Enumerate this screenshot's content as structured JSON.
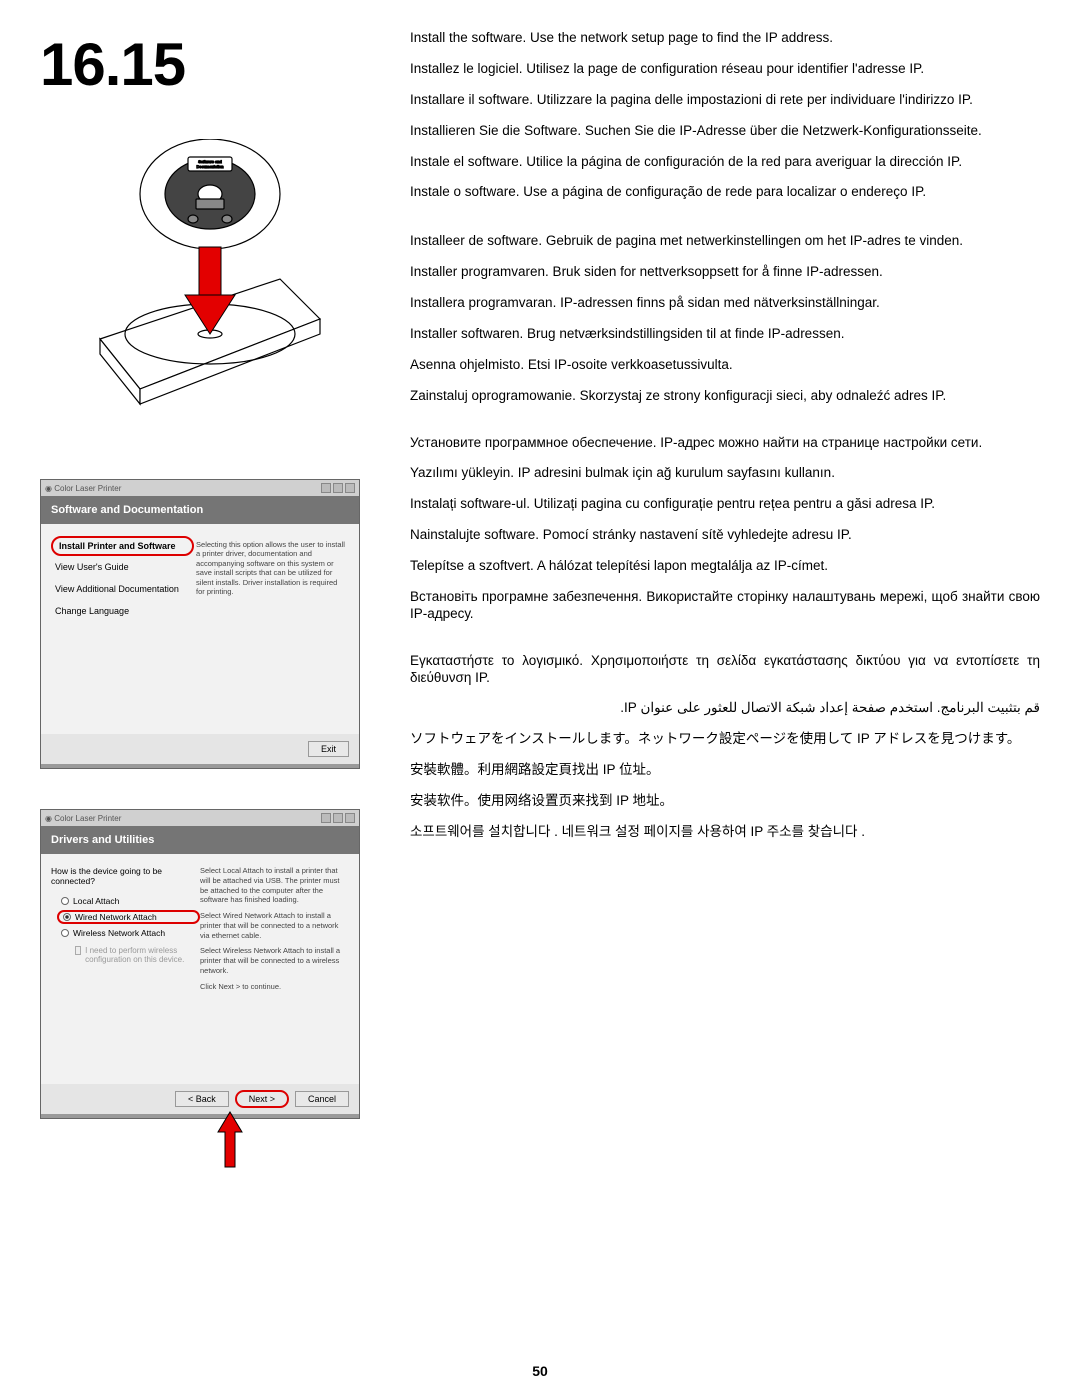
{
  "step_number": "16.15",
  "page_number": "50",
  "cd_label": "Software and Documentation",
  "installer1": {
    "window_title": "Color Laser Printer",
    "header": "Software and Documentation",
    "menu": {
      "install": "Install Printer and Software",
      "users_guide": "View User's Guide",
      "additional": "View Additional Documentation",
      "change_lang": "Change Language"
    },
    "desc": "Selecting this option allows the user to install a printer driver, documentation and accompanying software on this system or save install scripts that can be utilized for silent installs. Driver installation is required for printing.",
    "exit_btn": "Exit"
  },
  "installer2": {
    "window_title": "Color Laser Printer",
    "header": "Drivers and Utilities",
    "question": "How is the device going to be connected?",
    "opt_local": "Local Attach",
    "opt_wired": "Wired Network Attach",
    "opt_wireless": "Wireless Network Attach",
    "chk_text": "I need to perform wireless configuration on this device.",
    "desc_local": "Select Local Attach to install a printer that will be attached via USB. The printer must be attached to the computer after the software has finished loading.",
    "desc_wired": "Select Wired Network Attach to install a printer that will be connected to a network via ethernet cable.",
    "desc_wireless": "Select Wireless Network Attach to install a printer that will be connected to a wireless network.",
    "desc_next": "Click Next > to continue.",
    "back_btn": "< Back",
    "next_btn": "Next >",
    "cancel_btn": "Cancel"
  },
  "instructions": {
    "en": "Install the software. Use the network setup page to find the IP address.",
    "fr": "Installez le logiciel. Utilisez la page de configuration réseau pour identifier l'adresse IP.",
    "it": "Installare il software. Utilizzare la pagina delle impostazioni di rete per individuare l'indirizzo IP.",
    "de": "Installieren Sie die Software. Suchen Sie die IP-Adresse über die Netzwerk-Konfigurationsseite.",
    "es": "Instale el software. Utilice la página de configuración de la red para averiguar la dirección IP.",
    "pt": "Instale o software. Use a página de configuração de rede para localizar o endereço IP.",
    "nl": "Installeer de software. Gebruik de pagina met netwerkinstellingen om het IP-adres te vinden.",
    "no": "Installer programvaren. Bruk siden for nettverksoppsett for å finne IP-adressen.",
    "sv": "Installera programvaran. IP-adressen finns på sidan med nätverksinställningar.",
    "da": "Installer softwaren. Brug netværksindstillingsiden til at finde IP-adressen.",
    "fi": "Asenna ohjelmisto. Etsi IP-osoite verkkoasetussivulta.",
    "pl": "Zainstaluj oprogramowanie. Skorzystaj ze strony konfiguracji sieci, aby odnaleźć adres IP.",
    "ru": "Установите программное обеспечение. IP-адрес можно найти на странице настройки сети.",
    "tr": "Yazılımı yükleyin. IP adresini bulmak için ağ kurulum sayfasını kullanın.",
    "ro": "Instalați software-ul. Utilizați pagina cu configurație pentru rețea pentru a găsi adresa IP.",
    "cs": "Nainstalujte software. Pomocí stránky nastavení sítě vyhledejte adresu IP.",
    "hu": "Telepítse a szoftvert. A hálózat telepítési lapon megtalálja az IP-címet.",
    "uk": "Встановіть програмне забезпечення. Використайте сторінку налаштувань мережі, щоб знайти свою IP-адресу.",
    "el": "Εγκαταστήστε το λογισμικό. Χρησιμοποιήστε τη σελίδα εγκατάστασης δικτύου για να εντοπίσετε τη διεύθυνση IP.",
    "ar": "قم بتثبيت البرنامج. استخدم صفحة إعداد شبكة الاتصال للعثور على عنوان IP.",
    "ja": "ソフトウェアをインストールします。ネットワーク設定ページを使用して IP アドレスを見つけます。",
    "zh_tw": "安裝軟體。利用網路設定頁找出 IP 位址。",
    "zh_cn": "安装软件。使用网络设置页来找到 IP 地址。",
    "ko": "소프트웨어를 설치합니다 . 네트워크 설정 페이지를 사용하여 IP 주소를 찾습니다 ."
  }
}
